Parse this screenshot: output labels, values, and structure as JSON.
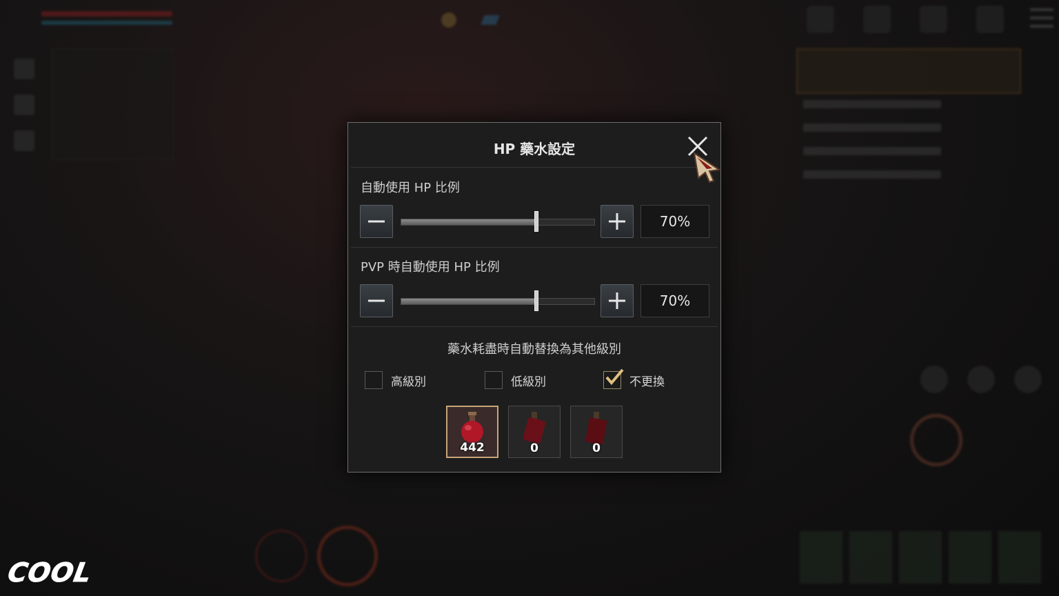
{
  "watermark": {
    "logo": "COOL"
  },
  "dialog": {
    "title": "HP 藥水設定",
    "close_icon": "close-icon",
    "auto_hp": {
      "label": "自動使用 HP 比例",
      "value_text": "70%",
      "percent": 70
    },
    "pvp_hp": {
      "label": "PVP 時自動使用 HP 比例",
      "value_text": "70%",
      "percent": 70
    },
    "replace": {
      "title": "藥水耗盡時自動替換為其他級別",
      "options": [
        {
          "label": "高級別",
          "checked": false
        },
        {
          "label": "低級別",
          "checked": false
        },
        {
          "label": "不更換",
          "checked": true
        }
      ]
    },
    "potions": [
      {
        "count": "442",
        "selected": true,
        "icon": "red-potion-flask-icon"
      },
      {
        "count": "0",
        "selected": false,
        "icon": "red-potion-bottle-icon"
      },
      {
        "count": "0",
        "selected": false,
        "icon": "red-potion-bottle-icon"
      }
    ]
  },
  "colors": {
    "accent_border": "#c9a57a",
    "checkmark": "#e0c080",
    "potion_red": "#b01828"
  }
}
